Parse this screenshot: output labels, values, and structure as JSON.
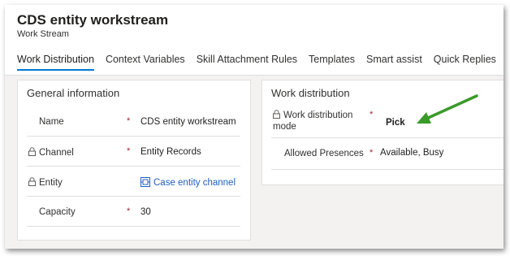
{
  "header": {
    "title": "CDS entity workstream",
    "subtitle": "Work Stream"
  },
  "tabs": [
    {
      "label": "Work Distribution",
      "active": true
    },
    {
      "label": "Context Variables"
    },
    {
      "label": "Skill Attachment Rules"
    },
    {
      "label": "Templates"
    },
    {
      "label": "Smart assist"
    },
    {
      "label": "Quick Replies"
    }
  ],
  "general": {
    "title": "General information",
    "fields": [
      {
        "label": "Name",
        "value": "CDS entity workstream",
        "required": "*",
        "locked": false
      },
      {
        "label": "Channel",
        "value": "Entity Records",
        "required": "*",
        "locked": true
      },
      {
        "label": "Entity",
        "value": "Case entity channel",
        "required": "",
        "locked": true,
        "icon": "entity-record-icon"
      },
      {
        "label": "Capacity",
        "value": "30",
        "required": "*",
        "locked": false
      }
    ]
  },
  "distribution": {
    "title": "Work distribution",
    "mode": {
      "label_line1": "Work distribution",
      "label_line2": "mode",
      "value": "Pick",
      "required": "*",
      "locked": true
    },
    "presences": {
      "label": "Allowed Presences",
      "value": "Available, Busy",
      "required": "*"
    }
  },
  "colors": {
    "accent": "#0078d4",
    "link": "#1f5fbf",
    "required": "#a4262c",
    "annotation_arrow": "#3a9a2a"
  },
  "icons": {
    "lock": "lock-icon",
    "entity": "entity-record-icon",
    "annotation": "green-arrow-icon"
  }
}
